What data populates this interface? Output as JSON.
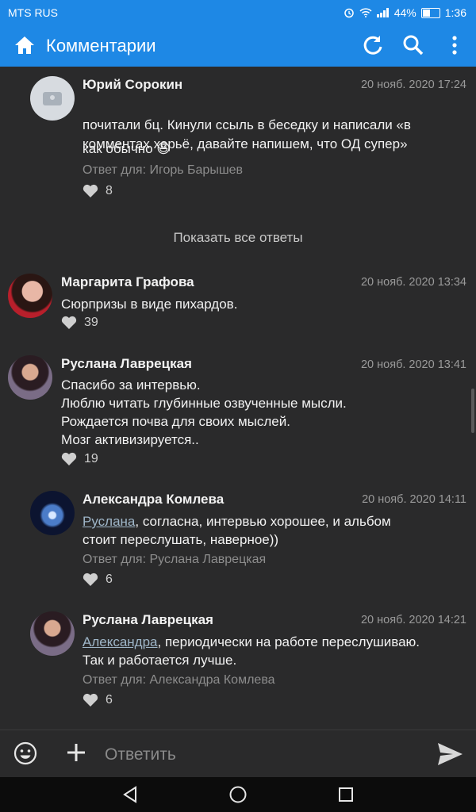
{
  "status_bar": {
    "carrier": "MTS RUS",
    "battery": "44%",
    "time": "1:36"
  },
  "toolbar": {
    "title": "Комментарии",
    "home_icon": "home-icon",
    "refresh_icon": "refresh-icon",
    "search_icon": "search-icon",
    "more_icon": "more-vert-icon"
  },
  "comments": [
    {
      "author": "Юрий Сорокин",
      "date": "20 нояб. 2020 17:24",
      "text": "почитали бц. Кинули ссыль в беседку и написали «в комментах херьё, давайте напишем, что ОД супер»",
      "text2": "как обычно 😆",
      "reply_to": "Ответ для: Игорь Барышев",
      "likes": "8"
    },
    {
      "author": "Маргарита Графова",
      "date": "20 нояб. 2020 13:34",
      "text": "Сюрпризы в виде пихардов.",
      "likes": "39"
    },
    {
      "author": "Руслана Лаврецкая",
      "date": "20 нояб. 2020 13:41",
      "text": "Спасибо за интервью.\nЛюблю читать глубинные озвученные мысли.\nРождается почва для своих мыслей.\nМозг активизируется..",
      "likes": "19"
    },
    {
      "author": "Александра Комлева",
      "date": "20 нояб. 2020 14:11",
      "mention": "Руслана",
      "text": ", согласна, интервью хорошее, и альбом\nстоит переслушать, наверное))",
      "reply_to": "Ответ для: Руслана Лаврецкая",
      "likes": "6"
    },
    {
      "author": "Руслана Лаврецкая",
      "date": "20 нояб. 2020 14:21",
      "mention": "Александра",
      "text": ", периодически на работе переслушиваю.\nТак и работается лучше.",
      "reply_to": "Ответ для: Александра Комлева",
      "likes": "6"
    }
  ],
  "show_all_replies": "Показать все ответы",
  "composer": {
    "placeholder": "Ответить",
    "emoji_icon": "emoji-icon",
    "attach_icon": "plus-icon",
    "send_icon": "send-icon"
  },
  "colors": {
    "accent": "#1e88e5",
    "background": "#2a2a2b",
    "secondary_text": "#9a9a9a"
  }
}
